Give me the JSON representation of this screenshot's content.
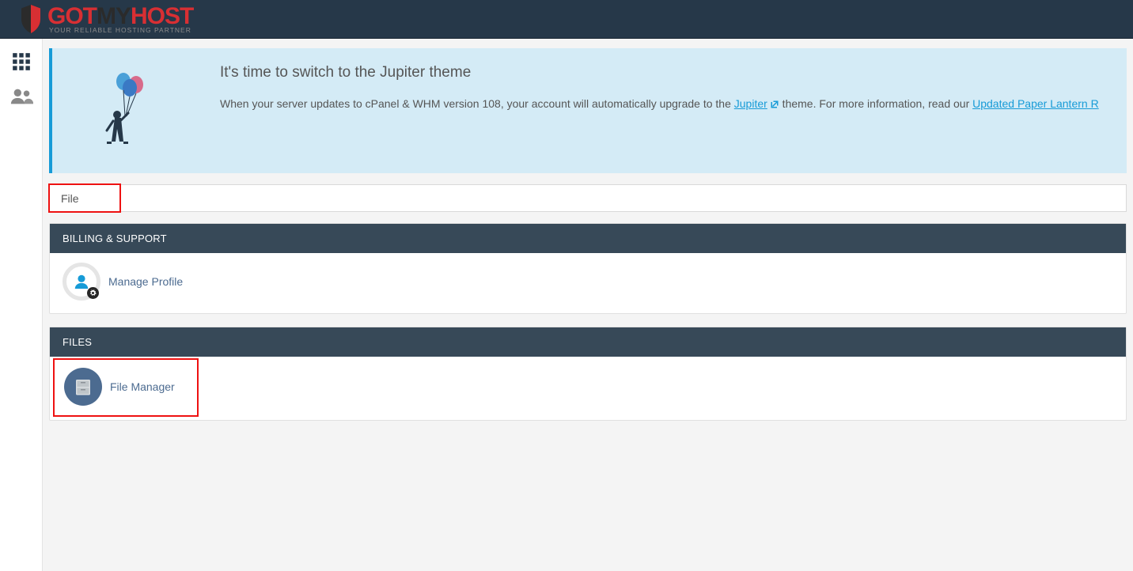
{
  "logo": {
    "got": "GOT",
    "my": "MY",
    "host": "HOST",
    "tagline": "YOUR RELIABLE HOSTING PARTNER"
  },
  "notice": {
    "title": "It's time to switch to the Jupiter theme",
    "text_pre": "When your server updates to cPanel & WHM version 108, your account will automatically upgrade to the ",
    "link1": "Jupiter",
    "text_mid": " theme. For more information, read our ",
    "link2": "Updated Paper Lantern R"
  },
  "search": {
    "value": "File"
  },
  "panels": {
    "billing": {
      "header": "BILLING & SUPPORT",
      "items": [
        {
          "label": "Manage Profile"
        }
      ]
    },
    "files": {
      "header": "FILES",
      "items": [
        {
          "label": "File Manager"
        }
      ]
    }
  }
}
